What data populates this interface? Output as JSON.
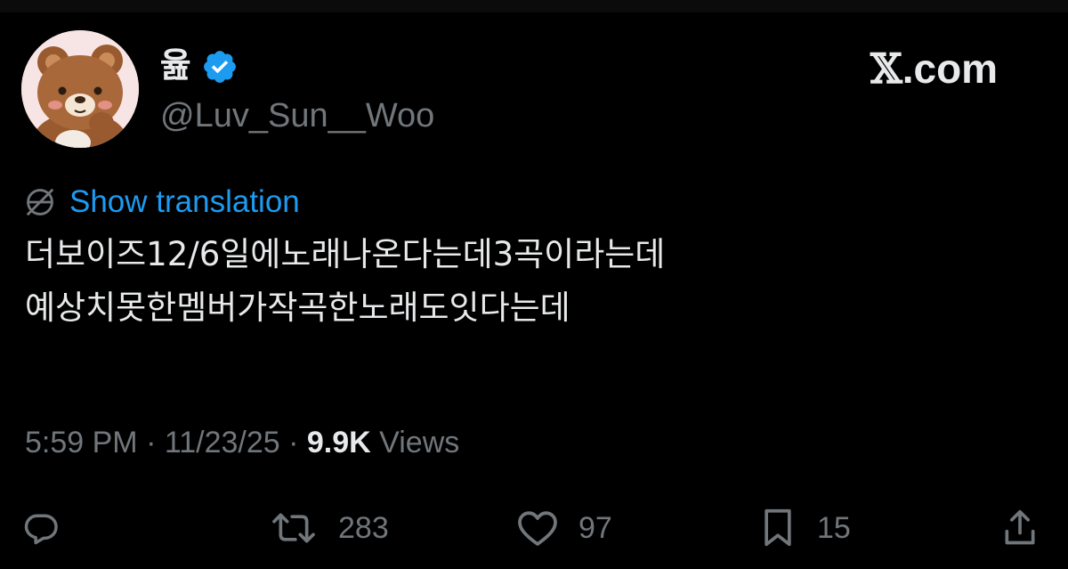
{
  "author": {
    "display_name": "윮",
    "handle": "@Luv_Sun__Woo",
    "verified": true,
    "avatar_icon": "bear-avatar-icon"
  },
  "brand": {
    "logo_text": "𝕏",
    "logo_suffix": ".com"
  },
  "translate": {
    "label": "Show translation",
    "icon": "globe-icon",
    "color": "#1d9bf0"
  },
  "tweet": {
    "lines": [
      "더보이즈12/6일에노래나온다는데3곡이라는데",
      "예상치못한멤버가작곡한노래도잇다는데"
    ]
  },
  "meta": {
    "time": "5:59 PM",
    "sep1": " · ",
    "date": "11/23/25",
    "sep2": " · ",
    "views_count": "9.9K",
    "views_label": " Views"
  },
  "actions": {
    "reply": {
      "icon": "reply-icon",
      "count": ""
    },
    "retweet": {
      "icon": "retweet-icon",
      "count": "283"
    },
    "like": {
      "icon": "heart-icon",
      "count": "97"
    },
    "bookmark": {
      "icon": "bookmark-icon",
      "count": "15"
    },
    "share": {
      "icon": "share-icon",
      "count": ""
    }
  },
  "colors": {
    "background": "#000000",
    "text": "#e7e9ea",
    "secondary": "#71767b",
    "verified_badge": "#1d9bf0"
  }
}
